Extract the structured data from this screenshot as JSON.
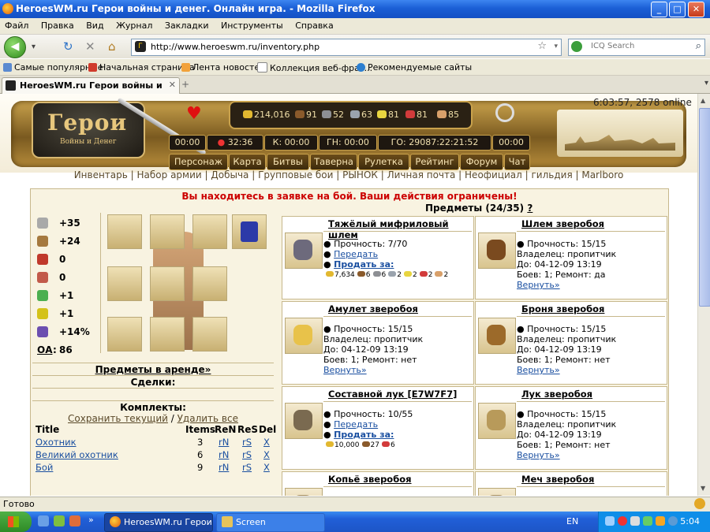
{
  "window": {
    "title": "HeroesWM.ru Герои войны и денег. Онлайн игра. - Mozilla Firefox",
    "minimize": "_",
    "maximize": "□",
    "close": "✕"
  },
  "menu": [
    "Файл",
    "Правка",
    "Вид",
    "Журнал",
    "Закладки",
    "Инструменты",
    "Справка"
  ],
  "toolbar": {
    "url": "http://www.heroeswm.ru/inventory.php",
    "search_placeholder": "ICQ Search"
  },
  "bookmarks": [
    "Самые популярные",
    "Начальная страница",
    "Лента новостей",
    "Коллекция веб-фраг...",
    "Рекомендуемые сайты"
  ],
  "tabs": [
    {
      "label": "HeroesWM.ru Герои войны и денег. ..."
    }
  ],
  "game": {
    "logo": {
      "title": "Герои",
      "subtitle": "Войны и Денег"
    },
    "online": "6:03:57, 2578 online",
    "resources": [
      {
        "value": "214,016",
        "icon": "gold-icon",
        "color": "#e2b830"
      },
      {
        "value": "91",
        "icon": "wood-icon",
        "color": "#8a5a2b"
      },
      {
        "value": "52",
        "icon": "ore-icon",
        "color": "#8d8f94"
      },
      {
        "value": "63",
        "icon": "mercury-icon",
        "color": "#9aa3ad"
      },
      {
        "value": "81",
        "icon": "sulfur-icon",
        "color": "#e8d540"
      },
      {
        "value": "81",
        "icon": "crystal-icon",
        "color": "#d23b3b"
      },
      {
        "value": "85",
        "icon": "gems-icon",
        "color": "#d8a06a"
      }
    ],
    "timers": [
      "00:00",
      "32:36",
      "К: 00:00",
      "ГН: 00:00",
      "ГО: 29087:22:21:52",
      "00:00"
    ],
    "nav": [
      "Персонаж",
      "Карта",
      "Битвы",
      "Таверна",
      "Рулетка",
      "Рейтинг",
      "Форум",
      "Чат"
    ],
    "sublinks": [
      "Инвентарь",
      "Набор армии",
      "Добыча",
      "Групповые бои",
      "РЫНОК",
      "Личная почта",
      "Неофициал",
      "гильдия",
      "Marlboro"
    ]
  },
  "inventory": {
    "warning": "Вы находитесь в заявке на бой. Ваши действия ограничены!",
    "items_count_label": "Предметы (24/35)",
    "help": "?",
    "stats": [
      {
        "icon": "attack-icon",
        "value": "+35",
        "color": "#a9a9a9"
      },
      {
        "icon": "defense-icon",
        "value": "+24",
        "color": "#a5793f"
      },
      {
        "icon": "spellpower-icon",
        "value": "0",
        "color": "#c0392b"
      },
      {
        "icon": "knowledge-icon",
        "value": "0",
        "color": "#c25a4a"
      },
      {
        "icon": "luck-icon",
        "value": "+1",
        "color": "#4caf50"
      },
      {
        "icon": "morale-icon",
        "value": "+1",
        "color": "#d4c21a"
      },
      {
        "icon": "initiative-icon",
        "value": "+14%",
        "color": "#6c4fb0"
      }
    ],
    "oa_label": "ОА",
    "oa_value": "86",
    "rent_link": "Предметы в аренде»",
    "deals_title": "Сделки:",
    "kits_title": "Комплекты:",
    "kits_save": "Сохранить текущий",
    "kits_delete": "Удалить все",
    "kits_header": {
      "title": "Title",
      "items": "Items",
      "ren": "ReN",
      "res": "ReS",
      "del": "Del"
    },
    "kits": [
      {
        "title": "Охотник",
        "items": "3",
        "ren": "rN",
        "res": "rS",
        "del": "X"
      },
      {
        "title": "Великий охотник",
        "items": "6",
        "ren": "rN",
        "res": "rS",
        "del": "X"
      },
      {
        "title": "Бой",
        "items": "9",
        "ren": "rN",
        "res": "rS",
        "del": "X"
      }
    ],
    "cards": [
      {
        "name": "Тяжёлый мифриловый шлем",
        "icon": "helmet-icon",
        "color": "#6d6a7c",
        "lines": [
          "Прочность: 7/70"
        ],
        "link1": "Передать",
        "link2": "Продать за:",
        "cost": [
          "7,634",
          "6",
          "6",
          "2",
          "2",
          "2",
          "2"
        ]
      },
      {
        "name": "Шлем зверобоя",
        "icon": "beast-helmet-icon",
        "color": "#7a4a1f",
        "lines": [
          "Прочность: 15/15",
          "Владелец: пропитчик",
          "До: 04-12-09 13:19",
          "Боев: 1;   Ремонт: да"
        ],
        "return_link": "Вернуть»"
      },
      {
        "name": "Амулет зверобоя",
        "icon": "amulet-icon",
        "color": "#e8c24a",
        "lines": [
          "Прочность: 15/15",
          "Владелец: пропитчик",
          "До: 04-12-09 13:19",
          "Боев: 1;   Ремонт: нет"
        ],
        "return_link": "Вернуть»"
      },
      {
        "name": "Броня зверобоя",
        "icon": "armor-icon",
        "color": "#9c6a2a",
        "lines": [
          "Прочность: 15/15",
          "Владелец: пропитчик",
          "До: 04-12-09 13:19",
          "Боев: 1;   Ремонт: нет"
        ],
        "return_link": "Вернуть»"
      },
      {
        "name": "Составной лук [E7W7F7]",
        "icon": "bow-icon",
        "color": "#7a6a50",
        "lines": [
          "Прочность: 10/55"
        ],
        "link1": "Передать",
        "link2": "Продать за:",
        "cost": [
          "10,000",
          "27",
          "6"
        ]
      },
      {
        "name": "Лук зверобоя",
        "icon": "beast-bow-icon",
        "color": "#b89a5a",
        "lines": [
          "Прочность: 15/15",
          "Владелец: пропитчик",
          "До: 04-12-09 13:19",
          "Боев: 1;   Ремонт: нет"
        ],
        "return_link": "Вернуть»"
      },
      {
        "name": "Копьё зверобоя",
        "icon": "spear-icon",
        "color": "#a08858"
      },
      {
        "name": "Меч зверобоя",
        "icon": "sword-icon",
        "color": "#a08858"
      }
    ]
  },
  "statusbar": {
    "text": "Готово"
  },
  "taskbar": {
    "tasks": [
      "HeroesWM.ru Герои в...",
      "Screen"
    ],
    "lang": "EN",
    "clock": "5:04"
  }
}
